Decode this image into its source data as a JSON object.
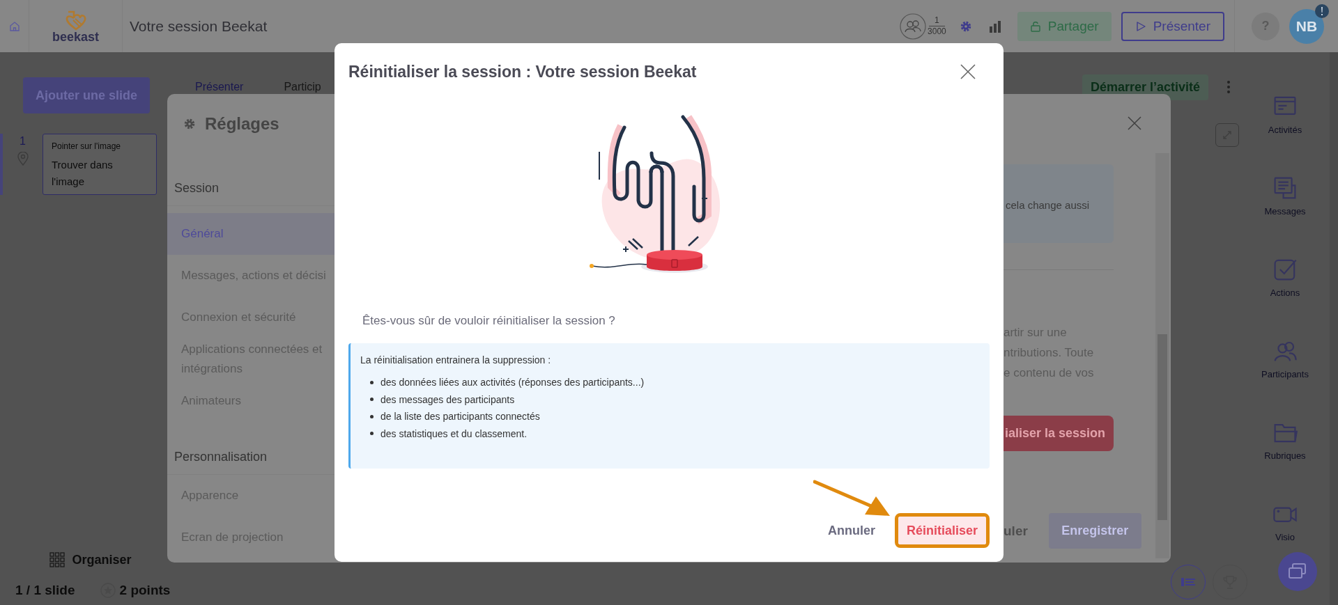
{
  "top_bar": {
    "logo": "beekast",
    "title": "Votre session Beekat",
    "participants": {
      "count": "1",
      "capacity": "3000"
    },
    "buttons": [
      {
        "label": "Partager",
        "kind": "share"
      },
      {
        "label": "Présenter",
        "kind": "present"
      }
    ],
    "help": "?",
    "avatar": "NB",
    "notification": true
  },
  "slides_panel": {
    "add_button": "Ajouter une slide",
    "slides": [
      {
        "number": "1",
        "type": "Pointer sur l'image",
        "title": "Trouver dans l'image",
        "selected": true
      }
    ],
    "organise": "Organiser",
    "counter": "1 / 1 slide",
    "points": "2 points"
  },
  "editor": {
    "tabs": [
      {
        "label": "Présenter",
        "selected": true
      },
      {
        "label": "Particip",
        "selected": false
      }
    ],
    "start_button": "Démarrer l’activité"
  },
  "right_sidebar": {
    "items": [
      {
        "label": "Activités"
      },
      {
        "label": "Messages"
      },
      {
        "label": "Actions"
      },
      {
        "label": "Participants"
      },
      {
        "label": "Rubriques"
      },
      {
        "label": "Visio"
      }
    ]
  },
  "settings_modal": {
    "title": "Réglages",
    "sections": [
      {
        "heading": "Session",
        "items": [
          {
            "label": "Général",
            "selected": true
          },
          {
            "label": "Messages, actions et décisi",
            "selected": false
          },
          {
            "label": "Connexion et sécurité",
            "selected": false
          },
          {
            "label": "Applications connectées et\nintégrations",
            "selected": false
          },
          {
            "label": "Animateurs",
            "selected": false
          }
        ]
      },
      {
        "heading": "Personnalisation",
        "items": [
          {
            "label": "Apparence",
            "selected": false
          },
          {
            "label": "Ecran de projection",
            "selected": false
          }
        ]
      }
    ],
    "info_fragment": "cela change aussi",
    "text_fragments": [
      "artir sur une",
      "ntributions. Toute",
      "e contenu de vos"
    ],
    "danger_button": "ialiser la session",
    "cancel": "uler",
    "save": {
      "label": "Enregistrer",
      "disabled": true
    }
  },
  "reset_modal": {
    "title": "Réinitialiser la session : Votre session Beekat",
    "question": "Êtes-vous sûr de vouloir réinitialiser la session ?",
    "info": {
      "intro": "La réinitialisation entrainera la suppression :",
      "items": [
        "des données liées aux activités (réponses des participants...)",
        "des messages des participants",
        "de la liste des participants connectés",
        "des statistiques et du classement."
      ]
    },
    "buttons": [
      {
        "label": "Annuler",
        "kind": "cancel",
        "highlighted": false
      },
      {
        "label": "Réinitialiser",
        "kind": "confirm",
        "highlighted": true
      }
    ],
    "pointer_arrow": true
  }
}
